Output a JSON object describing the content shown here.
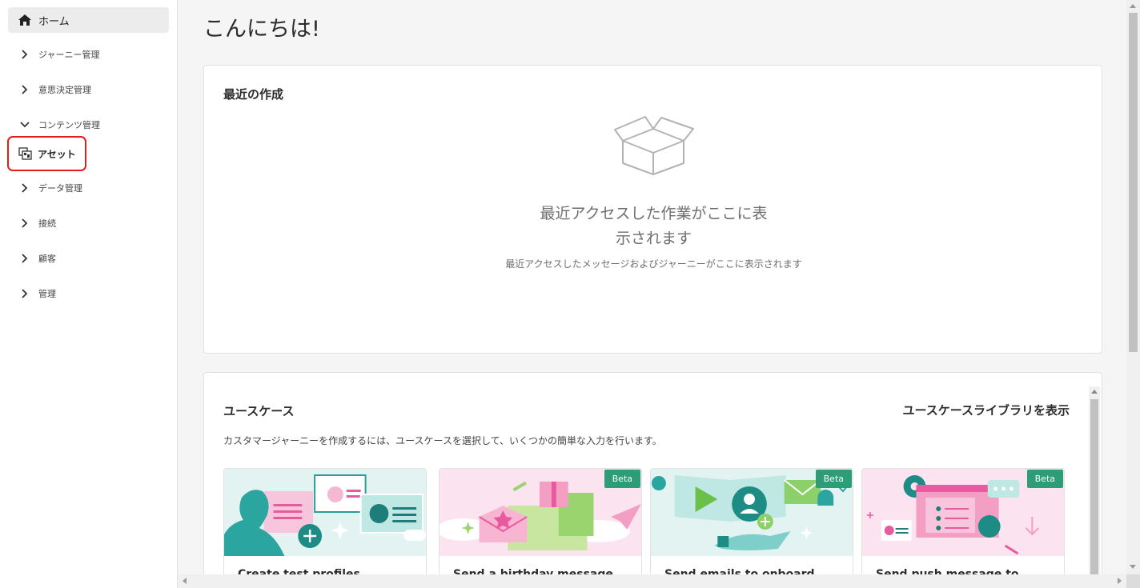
{
  "sidebar": {
    "home_label": "ホーム",
    "items": [
      {
        "label": "ジャーニー管理",
        "expanded": false
      },
      {
        "label": "意思決定管理",
        "expanded": false
      },
      {
        "label": "コンテンツ管理",
        "expanded": true
      },
      {
        "label": "データ管理",
        "expanded": false
      },
      {
        "label": "接続",
        "expanded": false
      },
      {
        "label": "顧客",
        "expanded": false
      },
      {
        "label": "管理",
        "expanded": false
      }
    ],
    "sub_item_label": "アセット",
    "highlight_color": "#e01e1e"
  },
  "main": {
    "greeting": "こんにちは!",
    "recent": {
      "title": "最近の作成",
      "empty_title_line1": "最近アクセスした作業がここに表",
      "empty_title_line2": "示されます",
      "empty_subtitle": "最近アクセスしたメッセージおよびジャーニーがここに表示されます",
      "icon": "empty-box-icon"
    },
    "use_cases": {
      "title": "ユースケース",
      "library_link": "ユースケースライブラリを表示",
      "description": "カスタマージャーニーを作成するには、ユースケースを選択して、いくつかの簡単な入力を行います。",
      "cards": [
        {
          "title": "Create test profiles",
          "beta": false
        },
        {
          "title": "Send a birthday message",
          "beta": true
        },
        {
          "title": "Send emails to onboard",
          "beta": true
        },
        {
          "title": "Send push message to",
          "beta": true
        }
      ],
      "beta_label": "Beta",
      "beta_color": "#2d9d78"
    }
  }
}
